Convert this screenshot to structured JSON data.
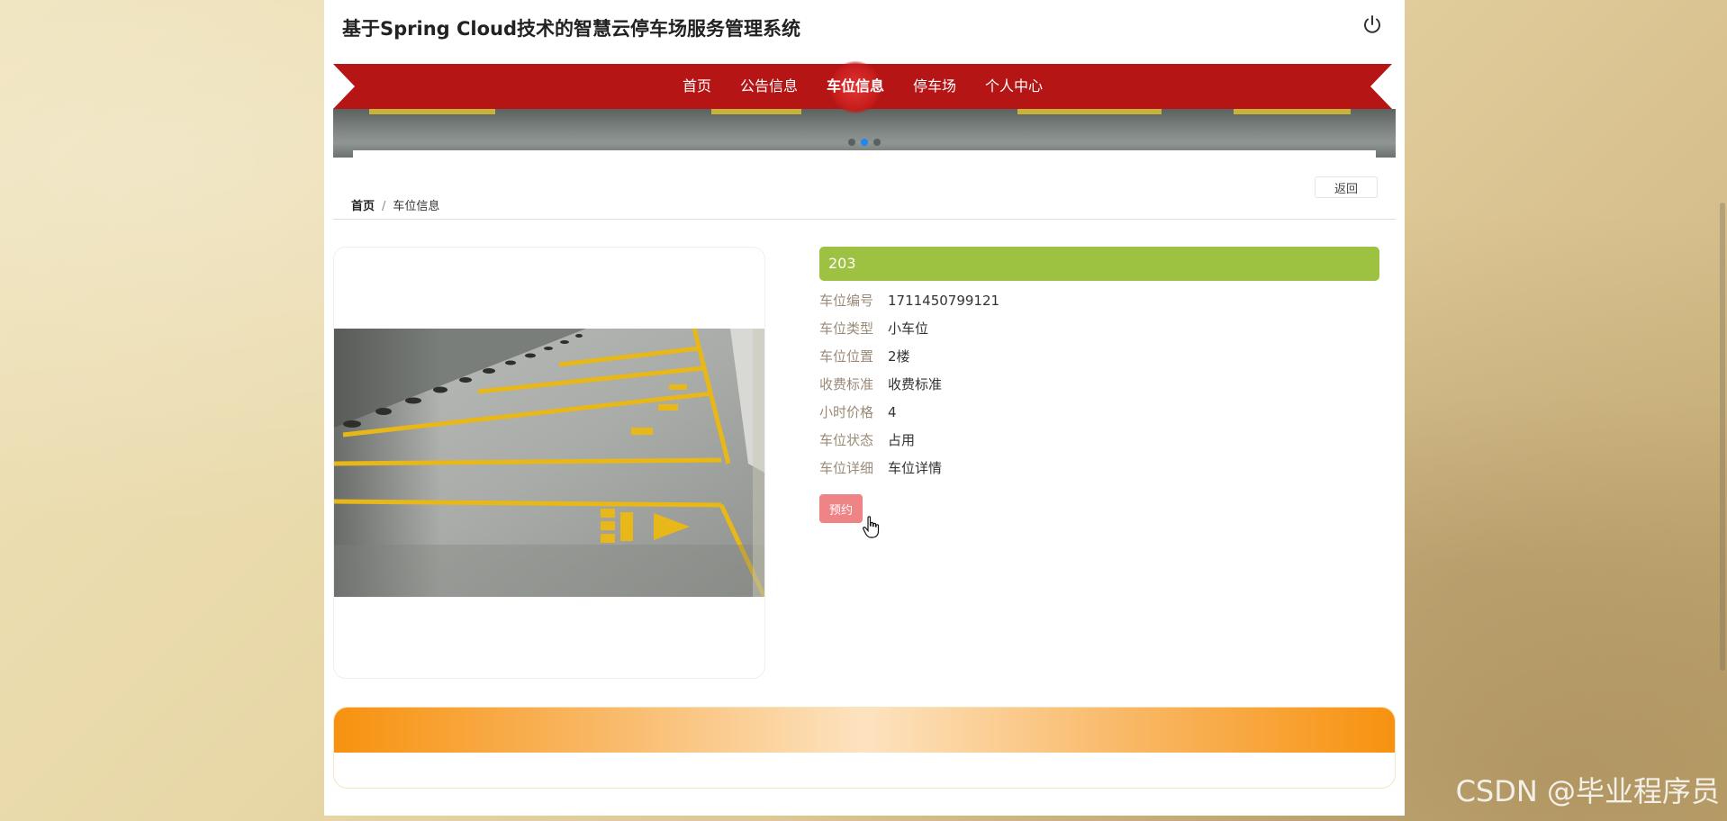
{
  "header": {
    "title": "基于Spring Cloud技术的智慧云停车场服务管理系统",
    "logout_icon": "power-icon"
  },
  "nav": {
    "items": [
      {
        "label": "首页",
        "active": false
      },
      {
        "label": "公告信息",
        "active": false
      },
      {
        "label": "车位信息",
        "active": true
      },
      {
        "label": "停车场",
        "active": false
      },
      {
        "label": "个人中心",
        "active": false
      }
    ]
  },
  "carousel": {
    "slide_count": 3,
    "active_index": 1
  },
  "toolbar": {
    "back_label": "返回"
  },
  "breadcrumb": {
    "home": "首页",
    "separator": "/",
    "current": "车位信息"
  },
  "detail": {
    "name": "203",
    "fields": [
      {
        "label": "车位编号",
        "value": "1711450799121"
      },
      {
        "label": "车位类型",
        "value": "小车位"
      },
      {
        "label": "车位位置",
        "value": "2楼"
      },
      {
        "label": "收费标准",
        "value": "收费标准"
      },
      {
        "label": "小时价格",
        "value": "4"
      },
      {
        "label": "车位状态",
        "value": "占用"
      },
      {
        "label": "车位详细",
        "value": "车位详情"
      }
    ],
    "reserve_label": "预约"
  },
  "watermark": "CSDN @毕业程序员",
  "colors": {
    "nav_red": "#b51515",
    "title_green": "#9dc242",
    "reserve_pink": "#ef8487",
    "footer_orange": "#f7920f"
  }
}
